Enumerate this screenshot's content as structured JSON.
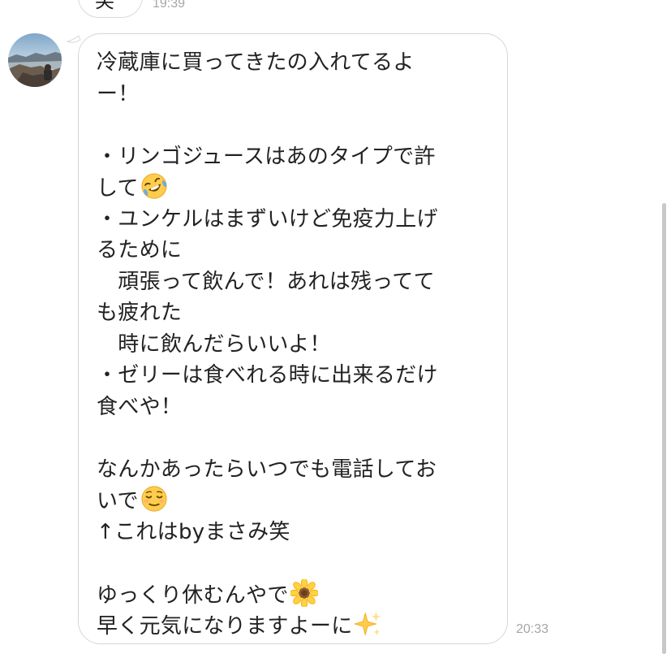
{
  "previous_message": {
    "text": "笑",
    "time": "19:39"
  },
  "message": {
    "lines": [
      "冷蔵庫に買ってきたの入れてるよ",
      "ー！",
      "",
      "・リンゴジュースはあのタイプで許",
      "して",
      "・ユンケルはまずいけど免疫力上げ",
      "るために",
      "　頑張って飲んで！あれは残ってて",
      "も疲れた",
      "　時に飲んだらいいよ！",
      "・ゼリーは食べれる時に出来るだけ",
      "食べや！",
      "",
      "なんかあったらいつでも電話してお",
      "いで",
      "↑これはbyまさみ笑",
      "",
      "ゆっくり休むんやで",
      "早く元気になりますよーに"
    ],
    "emojis": {
      "line_4": "rolling-on-floor-laughing-emoji",
      "line_14": "relieved-face-emoji",
      "line_17": "sunflower-emoji",
      "line_18": "sparkles-emoji"
    },
    "time": "20:33"
  },
  "colors": {
    "bubble_border": "#d6d6d6",
    "text": "#222222",
    "timestamp": "#a6a6a6"
  }
}
